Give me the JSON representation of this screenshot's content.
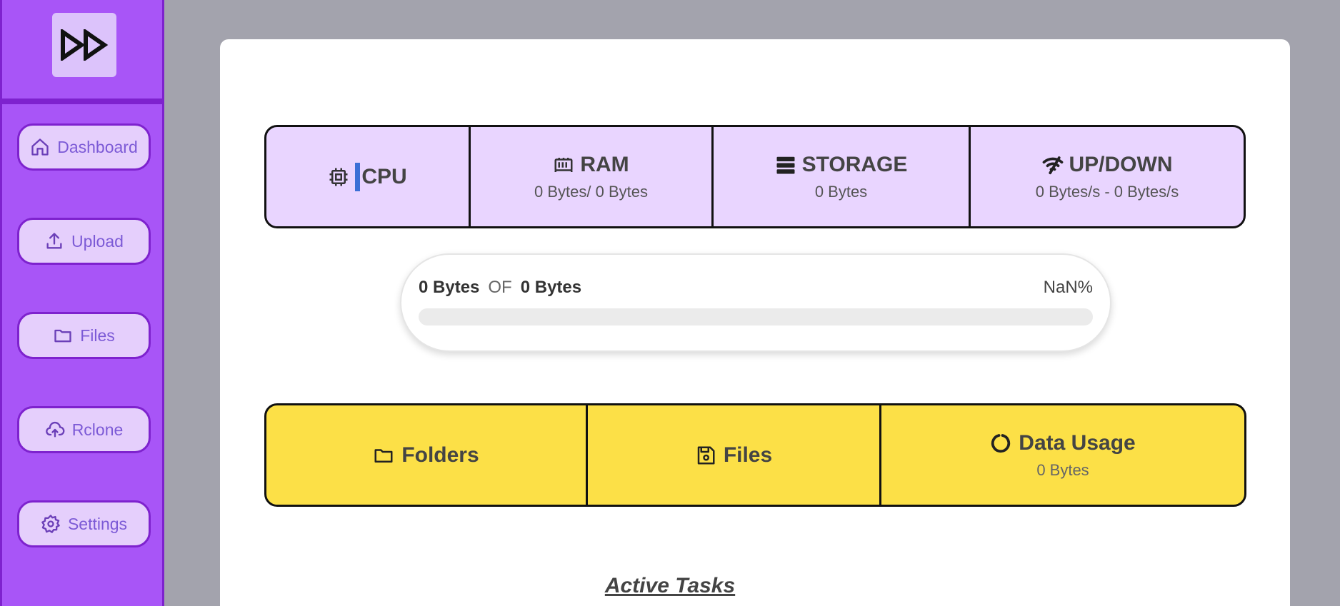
{
  "sidebar": {
    "logo_icon": "fast-forward-icon",
    "items": [
      {
        "label": "Dashboard",
        "icon": "home-icon"
      },
      {
        "label": "Upload",
        "icon": "upload-icon"
      },
      {
        "label": "Files",
        "icon": "folder-icon"
      },
      {
        "label": "Rclone",
        "icon": "cloud-upload-icon"
      },
      {
        "label": "Settings",
        "icon": "gear-icon"
      }
    ]
  },
  "stats": {
    "cpu": {
      "title": "CPU",
      "icon": "cpu-icon"
    },
    "ram": {
      "title": "RAM",
      "value": "0 Bytes/ 0 Bytes",
      "icon": "memory-icon"
    },
    "storage": {
      "title": "STORAGE",
      "value": "0 Bytes",
      "icon": "storage-icon"
    },
    "updown": {
      "title": "UP/DOWN",
      "value": "0 Bytes/s - 0 Bytes/s",
      "icon": "wifi-icon"
    }
  },
  "progress": {
    "used": "0 Bytes",
    "of_label": "OF",
    "total": "0 Bytes",
    "percent_text": "NaN%",
    "fill_fraction": 0
  },
  "items": {
    "folders": {
      "title": "Folders",
      "icon": "folder-icon"
    },
    "files": {
      "title": "Files",
      "icon": "save-icon"
    },
    "data_usage": {
      "title": "Data Usage",
      "value": "0 Bytes",
      "icon": "circle-notch-icon"
    }
  },
  "section_title": "Active Tasks",
  "colors": {
    "sidebar": "#a855f7",
    "sidebar_border": "#7e22ce",
    "stats_bg": "#e9d5ff",
    "items_bg": "#fce047"
  }
}
